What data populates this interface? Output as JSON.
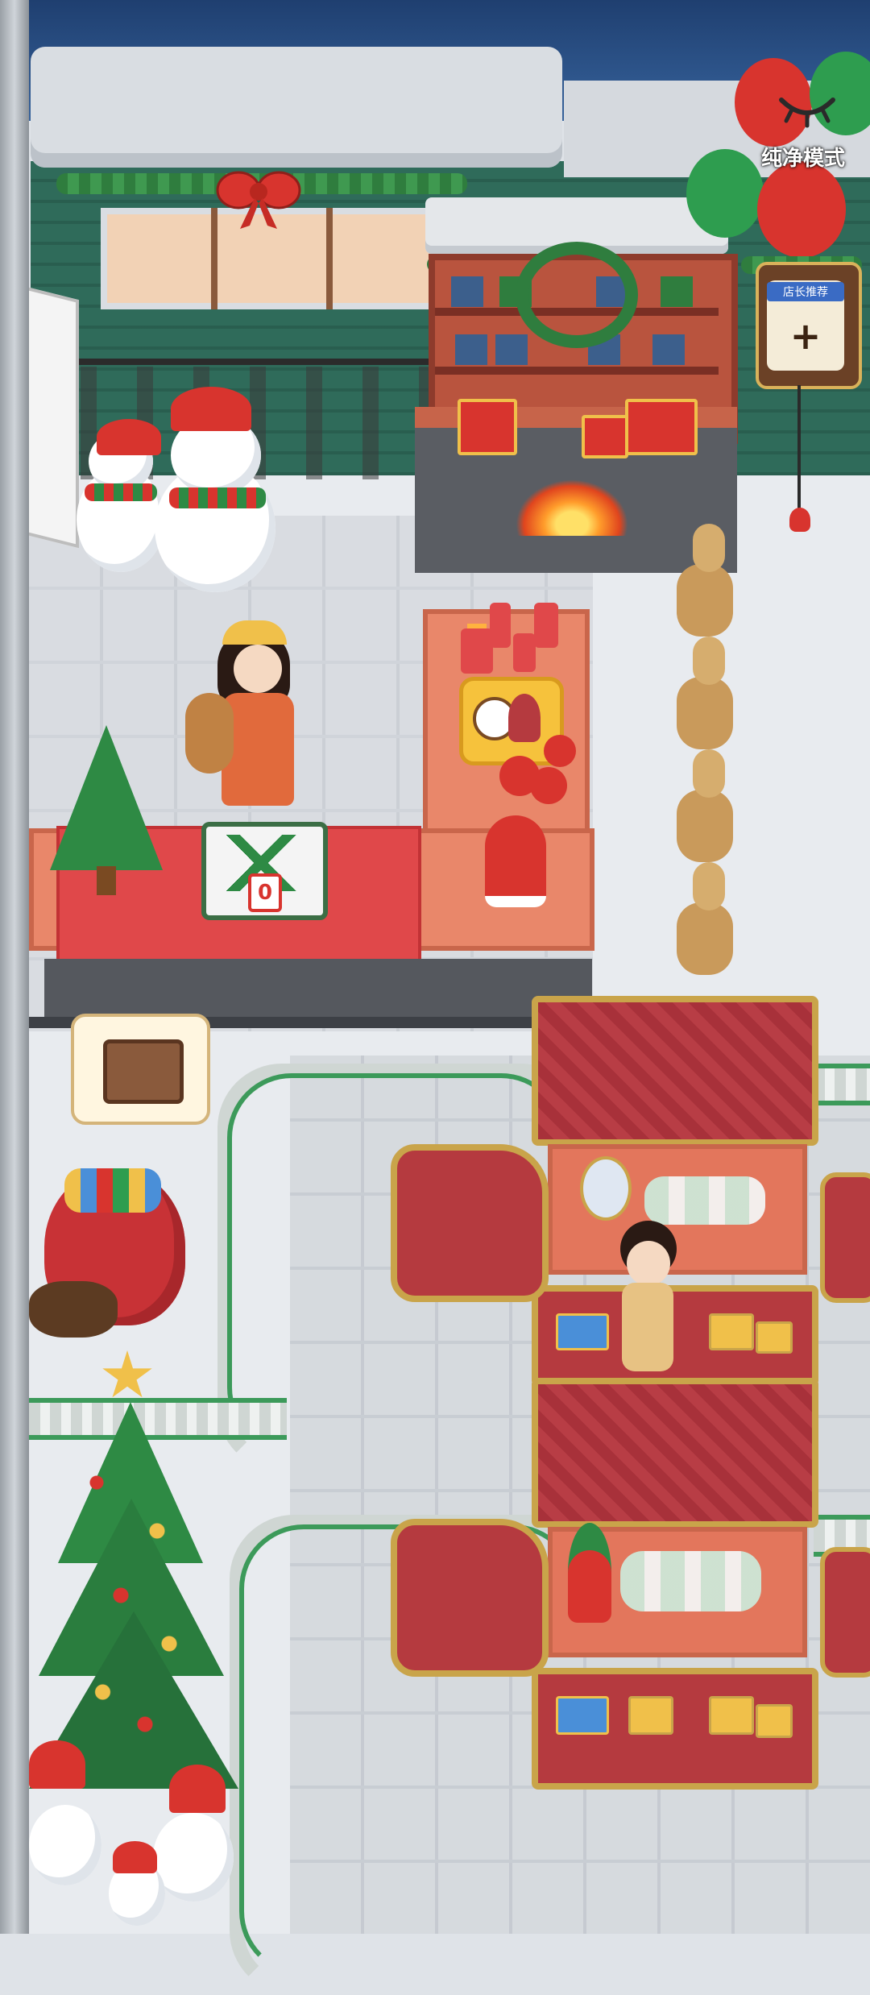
{
  "top_right": {
    "clean_mode_label": "纯净模式",
    "icon": "closed-eye-icon"
  },
  "recommend": {
    "label": "店长推荐",
    "plus": "+"
  },
  "counter_sign_value": "0",
  "colors": {
    "sky": "#2a4f86",
    "house": "#2f6b5a",
    "counter": "#e9876a",
    "tablecloth": "#e0484a",
    "sleigh": "#b53a3f",
    "track": "#3c9a5a"
  }
}
